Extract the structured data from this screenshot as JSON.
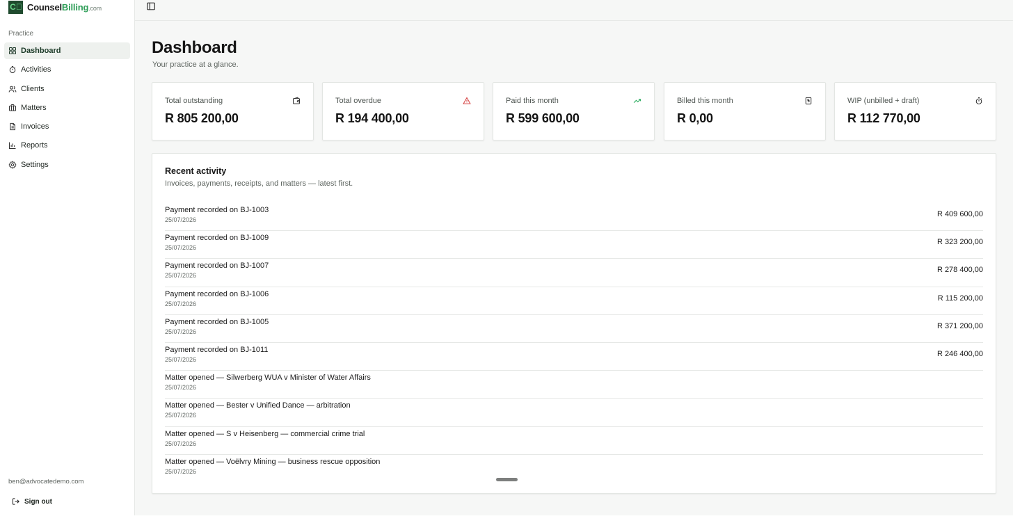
{
  "brand": {
    "mark": "C⃫",
    "name_part1": "Counsel",
    "name_part2": "Billing",
    "name_suffix": ".com"
  },
  "sidebar": {
    "group_label": "Practice",
    "items": [
      {
        "label": "Dashboard",
        "icon": "grid-icon",
        "active": true
      },
      {
        "label": "Activities",
        "icon": "stopwatch-icon"
      },
      {
        "label": "Clients",
        "icon": "users-icon"
      },
      {
        "label": "Matters",
        "icon": "briefcase-icon"
      },
      {
        "label": "Invoices",
        "icon": "document-icon"
      },
      {
        "label": "Reports",
        "icon": "bar-chart-icon"
      },
      {
        "label": "Settings",
        "icon": "gear-icon"
      }
    ],
    "user_email": "ben@advocatedemo.com",
    "sign_out_label": "Sign out"
  },
  "page": {
    "title": "Dashboard",
    "subtitle": "Your practice at a glance."
  },
  "stats": [
    {
      "label": "Total outstanding",
      "value": "R 805 200,00",
      "icon": "wallet-icon"
    },
    {
      "label": "Total overdue",
      "value": "R 194 400,00",
      "icon": "warning-triangle-icon"
    },
    {
      "label": "Paid this month",
      "value": "R 599 600,00",
      "icon": "trending-up-icon"
    },
    {
      "label": "Billed this month",
      "value": "R 0,00",
      "icon": "invoice-dollar-icon"
    },
    {
      "label": "WIP (unbilled + draft)",
      "value": "R 112 770,00",
      "icon": "stopwatch-icon"
    }
  ],
  "activity": {
    "title": "Recent activity",
    "subtitle": "Invoices, payments, receipts, and matters — latest first.",
    "items": [
      {
        "title": "Payment recorded on BJ-1003",
        "date": "25/07/2026",
        "amount": "R 409 600,00"
      },
      {
        "title": "Payment recorded on BJ-1009",
        "date": "25/07/2026",
        "amount": "R 323 200,00"
      },
      {
        "title": "Payment recorded on BJ-1007",
        "date": "25/07/2026",
        "amount": "R 278 400,00"
      },
      {
        "title": "Payment recorded on BJ-1006",
        "date": "25/07/2026",
        "amount": "R 115 200,00"
      },
      {
        "title": "Payment recorded on BJ-1005",
        "date": "25/07/2026",
        "amount": "R 371 200,00"
      },
      {
        "title": "Payment recorded on BJ-1011",
        "date": "25/07/2026",
        "amount": "R 246 400,00"
      },
      {
        "title": "Matter opened — Silwerberg WUA v Minister of Water Affairs",
        "date": "25/07/2026",
        "amount": ""
      },
      {
        "title": "Matter opened — Bester v Unified Dance — arbitration",
        "date": "25/07/2026",
        "amount": ""
      },
      {
        "title": "Matter opened — S v Heisenberg — commercial crime trial",
        "date": "25/07/2026",
        "amount": ""
      },
      {
        "title": "Matter opened — Voëlvry Mining — business rescue opposition",
        "date": "25/07/2026",
        "amount": ""
      }
    ]
  },
  "colors": {
    "brand_dark": "#1f4a2e",
    "brand_green": "#2f9e58",
    "danger": "#d64545",
    "success": "#2fae62"
  }
}
